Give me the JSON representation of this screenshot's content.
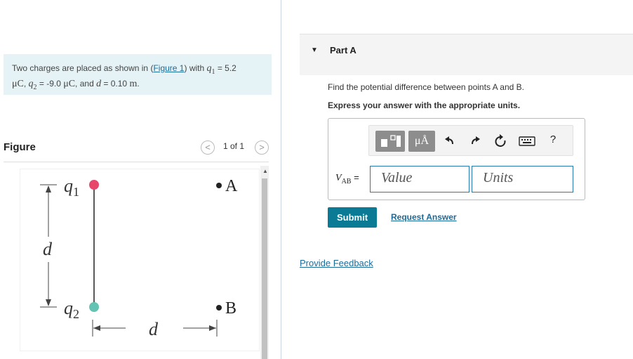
{
  "problem": {
    "text_before": "Two charges are placed as shown in (",
    "figure_link": "Figure 1",
    "text_after": ") with ",
    "q1_sym": "q",
    "q1_sub": "1",
    "q1_eq": " = 5.2",
    "unit1": "μC",
    "sep1": ", ",
    "q2_sym": "q",
    "q2_sub": "2",
    "q2_eq": " = -9.0 ",
    "unit2": "μC",
    "sep2": ", and ",
    "d_sym": "d",
    "d_eq": " = 0.10 ",
    "d_unit": "m",
    "end": "."
  },
  "figure_panel": {
    "title": "Figure",
    "pager": "1 of 1",
    "prev": "<",
    "next": ">"
  },
  "figure": {
    "q1_label": "q",
    "q1_sub": "1",
    "q2_label": "q",
    "q2_sub": "2",
    "d_vertical": "d",
    "d_horizontal": "d",
    "point_a": "A",
    "point_b": "B",
    "q1_color": "#e8456b",
    "q2_color": "#64c3b3"
  },
  "part": {
    "label": "Part A",
    "question": "Find the potential difference between points A and B.",
    "instruction": "Express your answer with the appropriate units."
  },
  "toolbar": {
    "units_label": "μÅ",
    "help": "?"
  },
  "answer": {
    "var_main": "V",
    "var_sub": "AB",
    "equals": " =",
    "value_placeholder": "Value",
    "units_placeholder": "Units"
  },
  "actions": {
    "submit": "Submit",
    "request_answer": "Request Answer",
    "feedback": "Provide Feedback"
  }
}
